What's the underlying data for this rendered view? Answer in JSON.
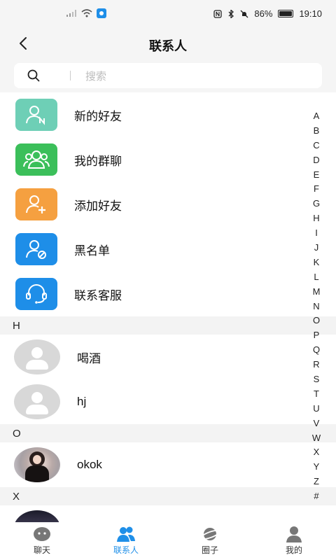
{
  "status_bar": {
    "battery": "86%",
    "time": "19:10",
    "battery_level": 0.86
  },
  "header": {
    "title": "联系人"
  },
  "search": {
    "placeholder": "搜索"
  },
  "system_items": [
    {
      "label": "新的好友",
      "icon": "new-friend-icon",
      "color": "#6ecfb6"
    },
    {
      "label": "我的群聊",
      "icon": "group-chat-icon",
      "color": "#3bbf5a"
    },
    {
      "label": "添加好友",
      "icon": "add-friend-icon",
      "color": "#f5a040"
    },
    {
      "label": "黑名单",
      "icon": "blacklist-icon",
      "color": "#1e8ee8"
    },
    {
      "label": "联系客服",
      "icon": "customer-service-icon",
      "color": "#1e8ee8"
    }
  ],
  "sections": [
    {
      "letter": "H",
      "contacts": [
        {
          "name": "喝酒"
        },
        {
          "name": "hj"
        }
      ]
    },
    {
      "letter": "O",
      "contacts": [
        {
          "name": "okok"
        }
      ]
    },
    {
      "letter": "X",
      "contacts": [
        {
          "name": ""
        }
      ]
    }
  ],
  "alphabet": [
    "A",
    "B",
    "C",
    "D",
    "E",
    "F",
    "G",
    "H",
    "I",
    "J",
    "K",
    "L",
    "M",
    "N",
    "O",
    "P",
    "Q",
    "R",
    "S",
    "T",
    "U",
    "V",
    "W",
    "X",
    "Y",
    "Z",
    "#"
  ],
  "tabs": [
    {
      "label": "聊天",
      "icon": "chat-icon",
      "active": false
    },
    {
      "label": "联系人",
      "icon": "contacts-icon",
      "active": true
    },
    {
      "label": "圈子",
      "icon": "planet-icon",
      "active": false
    },
    {
      "label": "我的",
      "icon": "profile-icon",
      "active": false
    }
  ],
  "colors": {
    "accent": "#1f8fe8",
    "background": "#f5f5f5"
  }
}
